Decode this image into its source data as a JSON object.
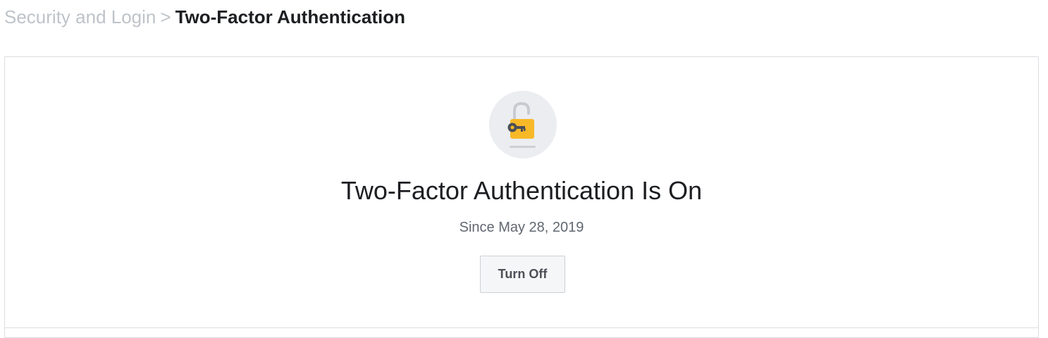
{
  "breadcrumb": {
    "parent": "Security and Login",
    "separator": ">",
    "current": "Two-Factor Authentication"
  },
  "status": {
    "icon": "unlocked-padlock-key-icon",
    "title": "Two-Factor Authentication Is On",
    "since": "Since May 28, 2019",
    "button_label": "Turn Off"
  },
  "colors": {
    "padlock_body": "#f7b928",
    "icon_background": "#ebedf0",
    "breadcrumb_inactive": "#bec3c9",
    "title_text": "#1c1e21"
  }
}
